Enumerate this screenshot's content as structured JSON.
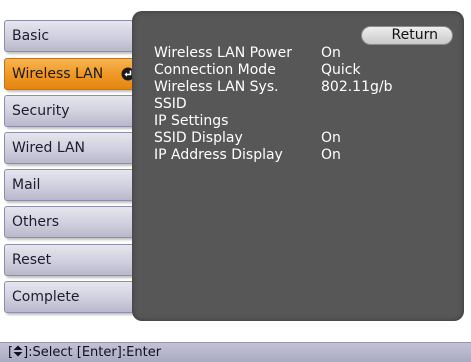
{
  "sidebar": {
    "items": [
      {
        "label": "Basic"
      },
      {
        "label": "Wireless LAN"
      },
      {
        "label": "Security"
      },
      {
        "label": "Wired LAN"
      },
      {
        "label": "Mail"
      },
      {
        "label": "Others"
      },
      {
        "label": "Reset"
      },
      {
        "label": "Complete"
      }
    ],
    "selected": "Wireless LAN",
    "selected_icon": "enter-arrow-icon"
  },
  "main": {
    "return_label": "Return",
    "settings": [
      {
        "label": "Wireless LAN Power",
        "value": "On"
      },
      {
        "label": "Connection Mode",
        "value": "Quick"
      },
      {
        "label": "Wireless LAN Sys.",
        "value": "802.11g/b"
      },
      {
        "label": "SSID",
        "value": ""
      },
      {
        "label": "IP Settings",
        "value": ""
      },
      {
        "label": "SSID Display",
        "value": "On"
      },
      {
        "label": "IP Address Display",
        "value": "On"
      }
    ]
  },
  "footer": {
    "bracket_open": "[",
    "select_hint": "]:Select  [Enter]:Enter"
  },
  "colors": {
    "panel_bg": "#575757",
    "active_tab": "#ef9724",
    "inactive_tab": "#cfcfde",
    "footer_bg": "#b5b5cc"
  }
}
